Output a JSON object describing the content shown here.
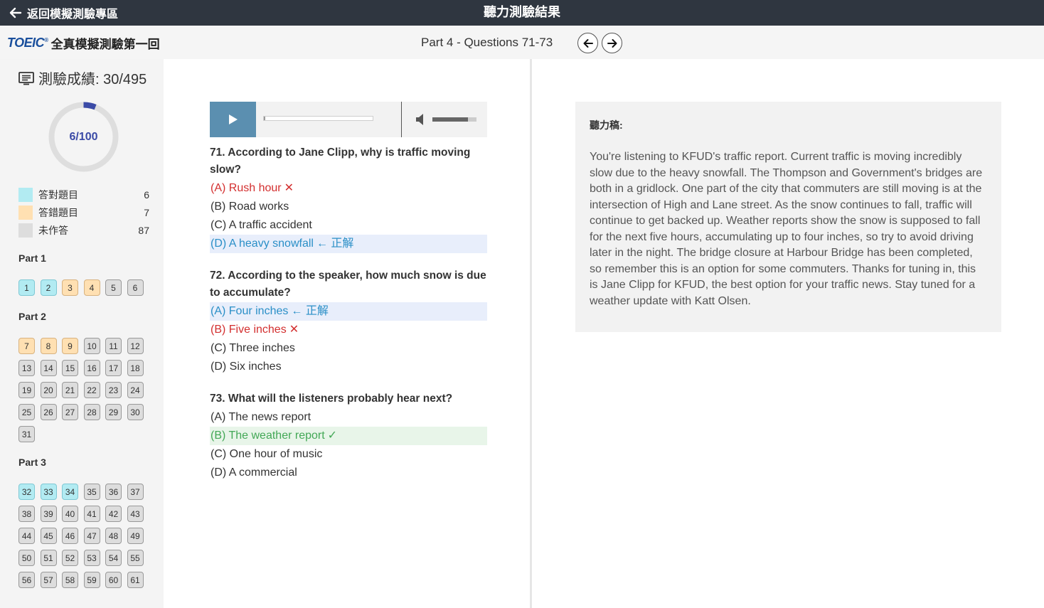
{
  "topbar": {
    "back_label": "返回模擬測驗專區",
    "title": "聽力測驗結果"
  },
  "subbar": {
    "brand_logo": "TOEIC",
    "brand_title": "全真模擬測驗第一回",
    "part_label": "Part 4 - Questions 71-73"
  },
  "sidebar": {
    "score_label": "測驗成績: 30/495",
    "progress": {
      "label": "6/100",
      "answered": 6,
      "total": 100
    },
    "legend": [
      {
        "label": "答對題目",
        "count": "6",
        "color": "#b2ebf2"
      },
      {
        "label": "答錯題目",
        "count": "7",
        "color": "#ffe0b2"
      },
      {
        "label": "未作答",
        "count": "87",
        "color": "#dddddd"
      }
    ],
    "parts": [
      {
        "name": "Part 1",
        "questions": [
          {
            "n": "1",
            "s": "correct"
          },
          {
            "n": "2",
            "s": "correct"
          },
          {
            "n": "3",
            "s": "wrong"
          },
          {
            "n": "4",
            "s": "wrong"
          },
          {
            "n": "5",
            "s": "none"
          },
          {
            "n": "6",
            "s": "none"
          }
        ]
      },
      {
        "name": "Part 2",
        "questions": [
          {
            "n": "7",
            "s": "wrong"
          },
          {
            "n": "8",
            "s": "wrong"
          },
          {
            "n": "9",
            "s": "wrong"
          },
          {
            "n": "10",
            "s": "none"
          },
          {
            "n": "11",
            "s": "none"
          },
          {
            "n": "12",
            "s": "none"
          },
          {
            "n": "13",
            "s": "none"
          },
          {
            "n": "14",
            "s": "none"
          },
          {
            "n": "15",
            "s": "none"
          },
          {
            "n": "16",
            "s": "none"
          },
          {
            "n": "17",
            "s": "none"
          },
          {
            "n": "18",
            "s": "none"
          },
          {
            "n": "19",
            "s": "none"
          },
          {
            "n": "20",
            "s": "none"
          },
          {
            "n": "21",
            "s": "none"
          },
          {
            "n": "22",
            "s": "none"
          },
          {
            "n": "23",
            "s": "none"
          },
          {
            "n": "24",
            "s": "none"
          },
          {
            "n": "25",
            "s": "none"
          },
          {
            "n": "26",
            "s": "none"
          },
          {
            "n": "27",
            "s": "none"
          },
          {
            "n": "28",
            "s": "none"
          },
          {
            "n": "29",
            "s": "none"
          },
          {
            "n": "30",
            "s": "none"
          },
          {
            "n": "31",
            "s": "none"
          }
        ]
      },
      {
        "name": "Part 3",
        "questions": [
          {
            "n": "32",
            "s": "correct"
          },
          {
            "n": "33",
            "s": "correct"
          },
          {
            "n": "34",
            "s": "correct"
          },
          {
            "n": "35",
            "s": "none"
          },
          {
            "n": "36",
            "s": "none"
          },
          {
            "n": "37",
            "s": "none"
          },
          {
            "n": "38",
            "s": "none"
          },
          {
            "n": "39",
            "s": "none"
          },
          {
            "n": "40",
            "s": "none"
          },
          {
            "n": "41",
            "s": "none"
          },
          {
            "n": "42",
            "s": "none"
          },
          {
            "n": "43",
            "s": "none"
          },
          {
            "n": "44",
            "s": "none"
          },
          {
            "n": "45",
            "s": "none"
          },
          {
            "n": "46",
            "s": "none"
          },
          {
            "n": "47",
            "s": "none"
          },
          {
            "n": "48",
            "s": "none"
          },
          {
            "n": "49",
            "s": "none"
          },
          {
            "n": "50",
            "s": "none"
          },
          {
            "n": "51",
            "s": "none"
          },
          {
            "n": "52",
            "s": "none"
          },
          {
            "n": "53",
            "s": "none"
          },
          {
            "n": "54",
            "s": "none"
          },
          {
            "n": "55",
            "s": "none"
          },
          {
            "n": "56",
            "s": "none"
          },
          {
            "n": "57",
            "s": "none"
          },
          {
            "n": "58",
            "s": "none"
          },
          {
            "n": "59",
            "s": "none"
          },
          {
            "n": "60",
            "s": "none"
          },
          {
            "n": "61",
            "s": "none"
          }
        ]
      }
    ]
  },
  "player": {
    "progress_fraction": 0.01,
    "volume_fraction": 0.8
  },
  "questions": [
    {
      "title": "71. According to Jane Clipp, why is traffic moving slow?",
      "options": [
        {
          "text": "(A) Rush hour",
          "state": "wrong",
          "mark": "✕"
        },
        {
          "text": "(B) Road works",
          "state": "none",
          "mark": ""
        },
        {
          "text": "(C) A traffic accident",
          "state": "none",
          "mark": ""
        },
        {
          "text": "(D) A heavy snowfall",
          "state": "correct",
          "mark": "← 正解"
        }
      ]
    },
    {
      "title": "72. According to the speaker, how much snow is due to accumulate?",
      "options": [
        {
          "text": "(A) Four inches",
          "state": "correct",
          "mark": "← 正解"
        },
        {
          "text": "(B) Five inches",
          "state": "wrong",
          "mark": "✕"
        },
        {
          "text": "(C) Three inches",
          "state": "none",
          "mark": ""
        },
        {
          "text": "(D) Six inches",
          "state": "none",
          "mark": ""
        }
      ]
    },
    {
      "title": "73. What will the listeners probably hear next?",
      "options": [
        {
          "text": "(A) The news report",
          "state": "none",
          "mark": ""
        },
        {
          "text": "(B) The weather report",
          "state": "right",
          "mark": "✓"
        },
        {
          "text": "(C) One hour of music",
          "state": "none",
          "mark": ""
        },
        {
          "text": "(D) A commercial",
          "state": "none",
          "mark": ""
        }
      ]
    }
  ],
  "transcript": {
    "label": "聽力稿:",
    "text": "You're listening to KFUD's traffic report. Current traffic is moving incredibly slow due to the heavy snowfall. The Thompson and Government's bridges are both in a gridlock. One part of the city that commuters are still moving is at the intersection of High and Lane street. As the snow continues to fall, traffic will continue to get backed up. Weather reports show the snow is supposed to fall for the next five hours, accumulating up to four inches, so try to avoid driving later in the night. The bridge closure at Harbour Bridge has been completed, so remember this is an option for some commuters. Thanks for tuning in, this is Jane Clipp for KFUD, the best option for your traffic news. Stay tuned for a weather update with Katt Olsen."
  }
}
